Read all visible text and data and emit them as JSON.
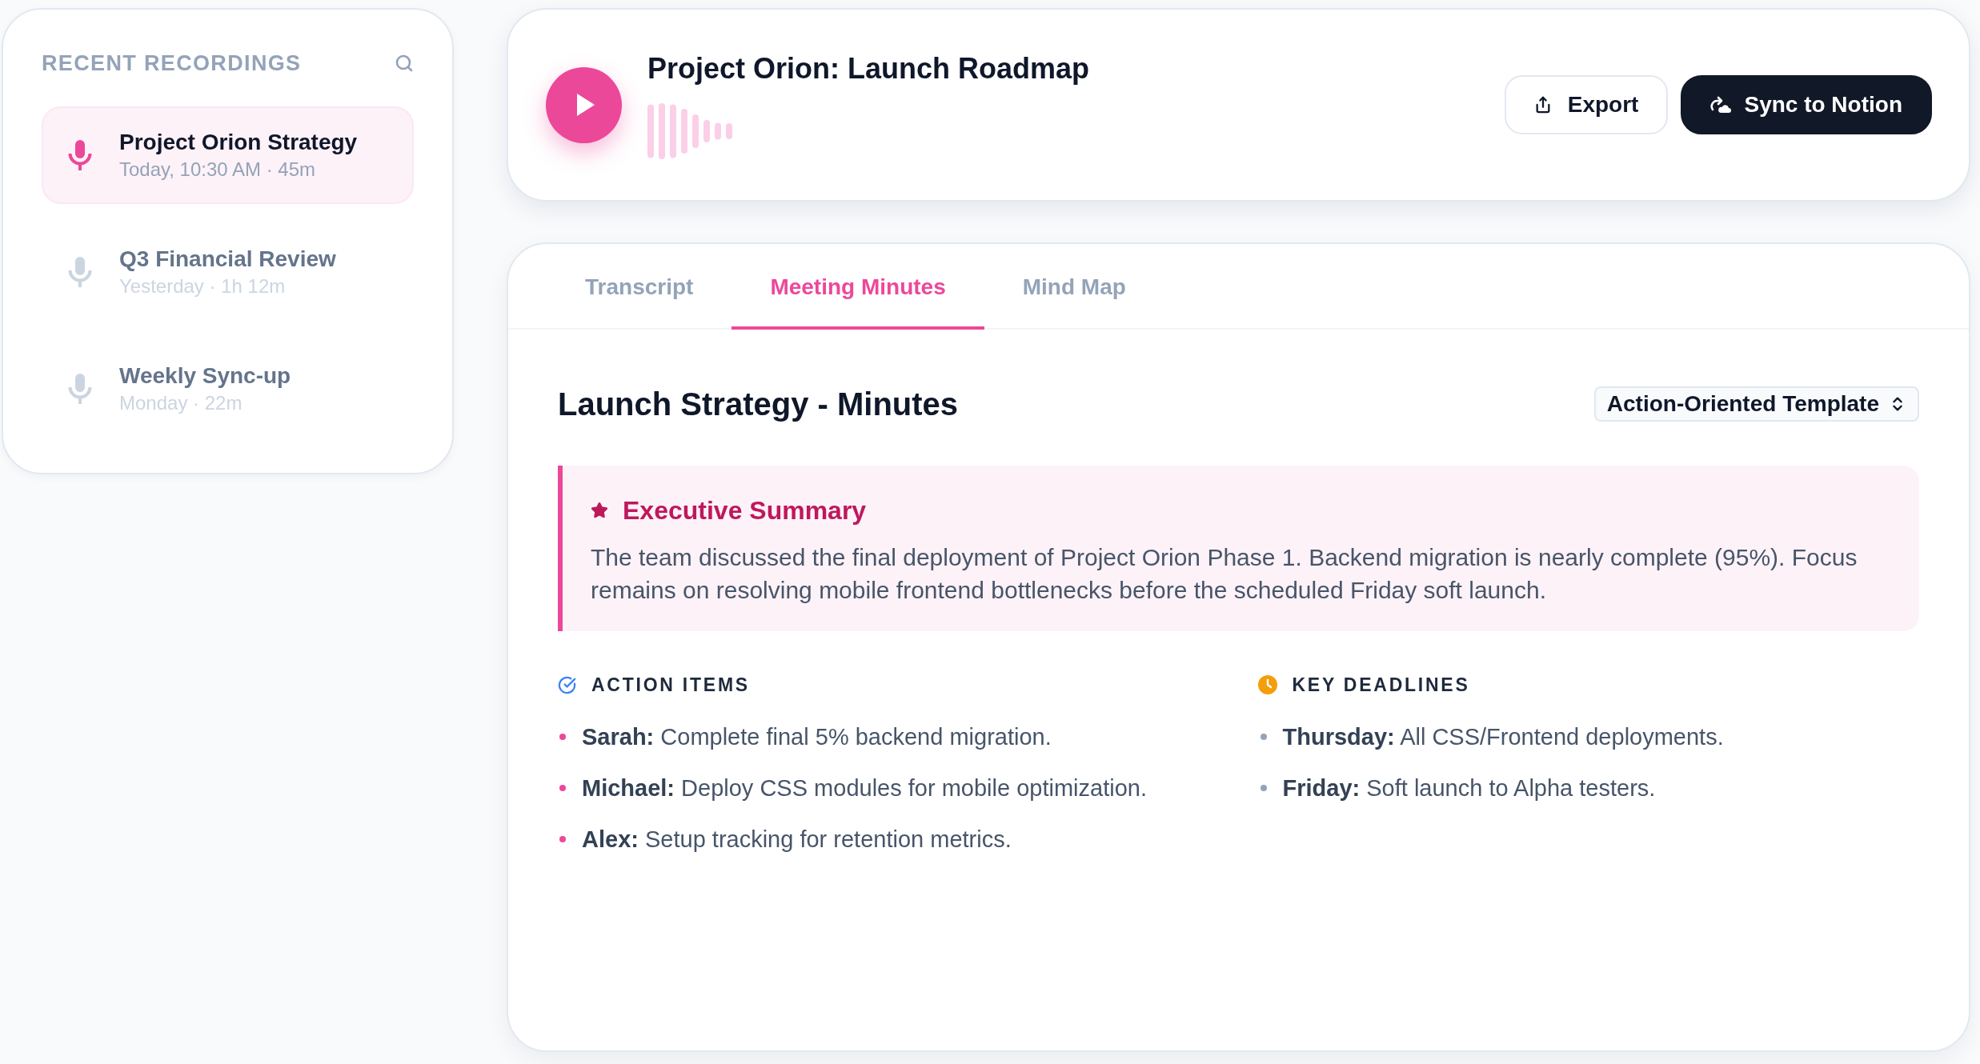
{
  "sidebar": {
    "title": "RECENT RECORDINGS",
    "items": [
      {
        "title": "Project Orion Strategy",
        "meta": "Today, 10:30 AM · 45m",
        "selected": true
      },
      {
        "title": "Q3 Financial Review",
        "meta": "Yesterday · 1h 12m",
        "selected": false
      },
      {
        "title": "Weekly Sync-up",
        "meta": "Monday · 22m",
        "selected": false
      }
    ]
  },
  "player": {
    "title": "Project Orion: Launch Roadmap",
    "actions": [
      {
        "label": "Export",
        "kind": "secondary"
      },
      {
        "label": "Sync to Notion",
        "kind": "primary"
      }
    ]
  },
  "tabs": [
    {
      "label": "Transcript",
      "selected": false
    },
    {
      "label": "Meeting Minutes",
      "selected": true
    },
    {
      "label": "Mind Map",
      "selected": false
    }
  ],
  "minutes": {
    "title": "Launch Strategy - Minutes",
    "template_select": {
      "value": "Action-Oriented Template"
    },
    "summary": {
      "title": "Executive Summary",
      "text": "The team discussed the final deployment of Project Orion Phase 1. Backend migration is nearly complete (95%). Focus remains on resolving mobile frontend bottlenecks before the scheduled Friday soft launch."
    },
    "sections": [
      {
        "title": "ACTION ITEMS",
        "kind": "actions",
        "items": [
          "**Sarah:** Complete final 5% backend migration.",
          "**Michael:** Deploy CSS modules for mobile optimization.",
          "**Alex:** Setup tracking for retention metrics."
        ]
      },
      {
        "title": "KEY DEADLINES",
        "kind": "deadlines",
        "items": [
          "**Thursday:** All CSS/Frontend deployments.",
          "**Friday:** Soft launch to Alpha testers."
        ]
      }
    ]
  }
}
